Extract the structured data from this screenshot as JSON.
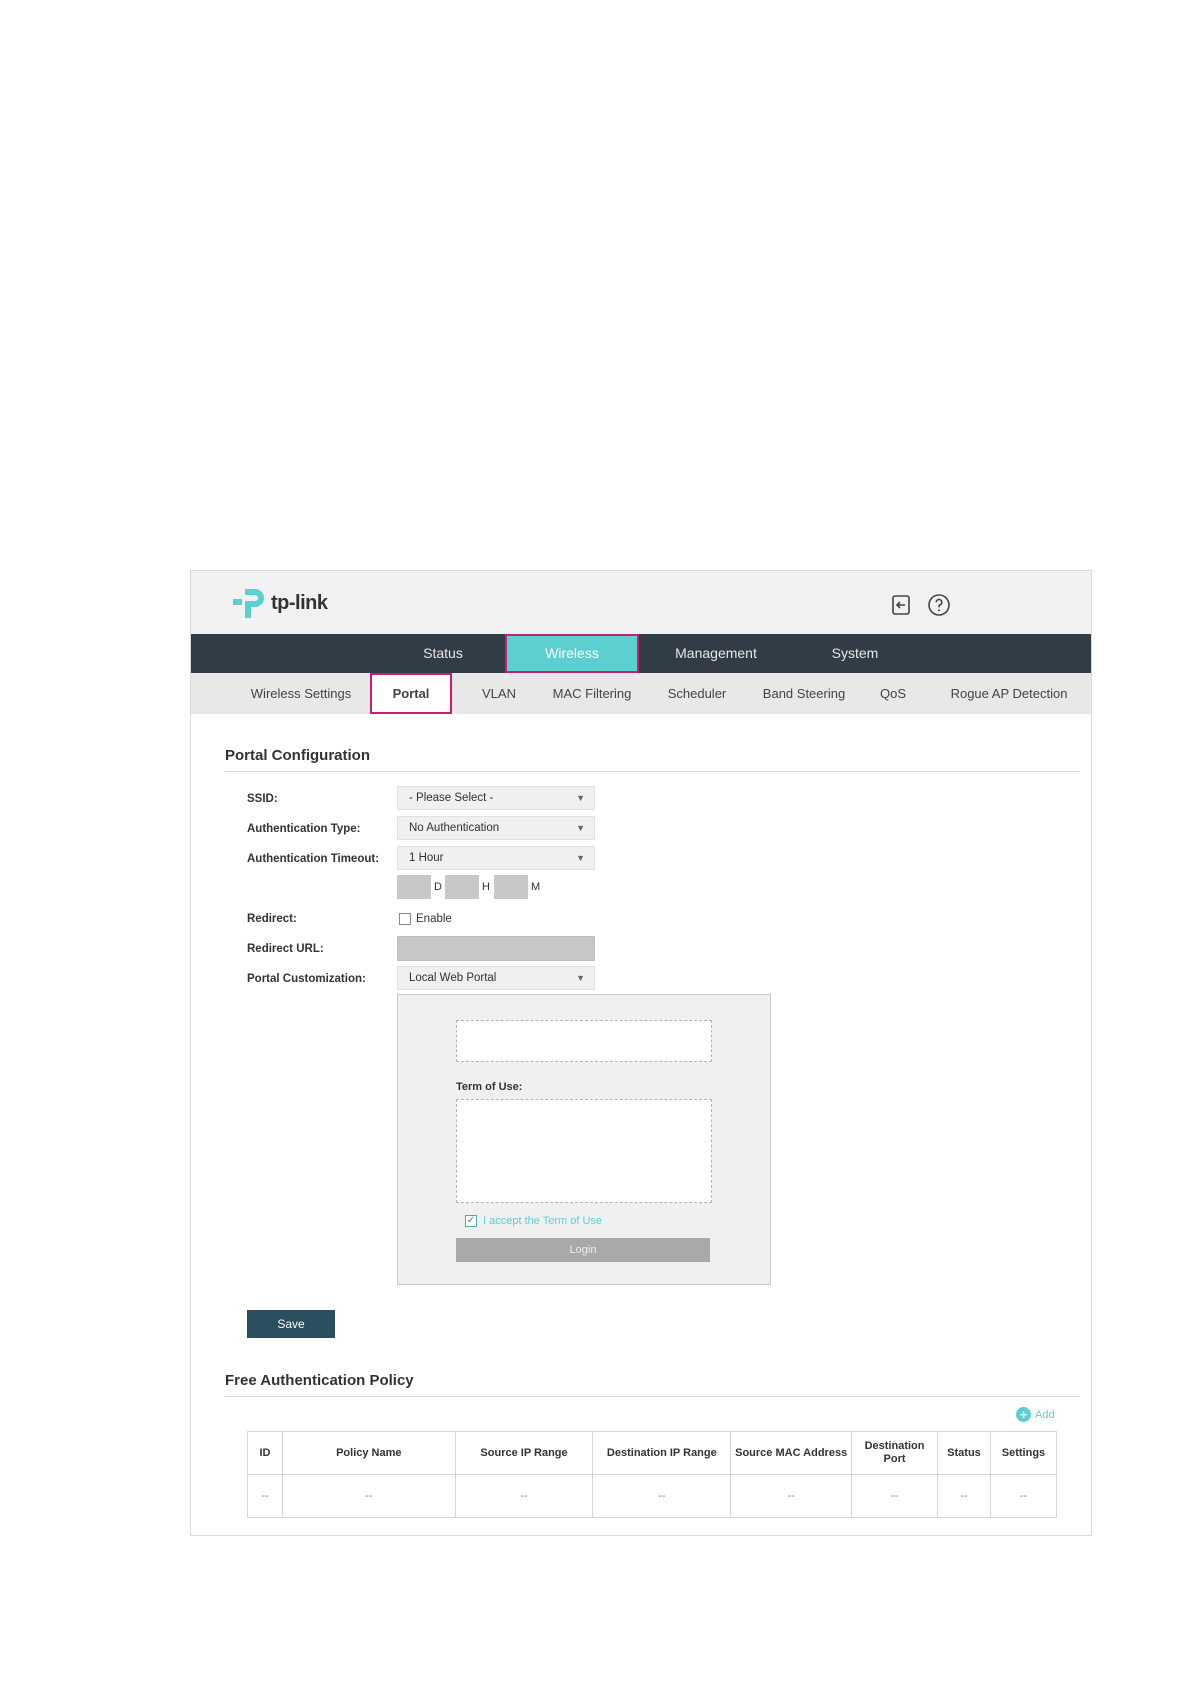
{
  "brand": {
    "name": "tp-link"
  },
  "header_icons": [
    "logout-icon",
    "help-icon"
  ],
  "main_nav": [
    {
      "label": "Status",
      "active": false
    },
    {
      "label": "Wireless",
      "active": true
    },
    {
      "label": "Management",
      "active": false
    },
    {
      "label": "System",
      "active": false
    }
  ],
  "sub_nav": [
    {
      "label": "Wireless Settings",
      "active": false
    },
    {
      "label": "Portal",
      "active": true
    },
    {
      "label": "VLAN",
      "active": false
    },
    {
      "label": "MAC Filtering",
      "active": false
    },
    {
      "label": "Scheduler",
      "active": false
    },
    {
      "label": "Band Steering",
      "active": false
    },
    {
      "label": "QoS",
      "active": false
    },
    {
      "label": "Rogue AP Detection",
      "active": false
    }
  ],
  "portal_config": {
    "title": "Portal Configuration",
    "ssid": {
      "label": "SSID:",
      "value": "- Please Select -"
    },
    "auth_type": {
      "label": "Authentication Type:",
      "value": "No Authentication"
    },
    "auth_timeout": {
      "label": "Authentication Timeout:",
      "value": "1 Hour"
    },
    "timeout_units": {
      "d": "D",
      "h": "H",
      "m": "M"
    },
    "redirect": {
      "label": "Redirect:",
      "option": "Enable",
      "checked": false
    },
    "redirect_url": {
      "label": "Redirect URL:",
      "value": ""
    },
    "portal_customization": {
      "label": "Portal Customization:",
      "value": "Local Web Portal"
    },
    "preview": {
      "term_label": "Term of Use:",
      "accept_text": "I accept the Term of Use",
      "accept_checked": true,
      "login_label": "Login"
    },
    "save_label": "Save"
  },
  "free_auth": {
    "title": "Free Authentication Policy",
    "add_label": "Add",
    "columns": [
      "ID",
      "Policy Name",
      "Source IP Range",
      "Destination IP Range",
      "Source MAC Address",
      "Destination Port",
      "Status",
      "Settings"
    ],
    "rows": [
      [
        "--",
        "--",
        "--",
        "--",
        "--",
        "--",
        "--",
        "--"
      ]
    ]
  },
  "colors": {
    "nav_bg": "#323c46",
    "accent": "#5ccfd0",
    "highlight": "#c4226f",
    "save_bg": "#2b4f5e"
  }
}
